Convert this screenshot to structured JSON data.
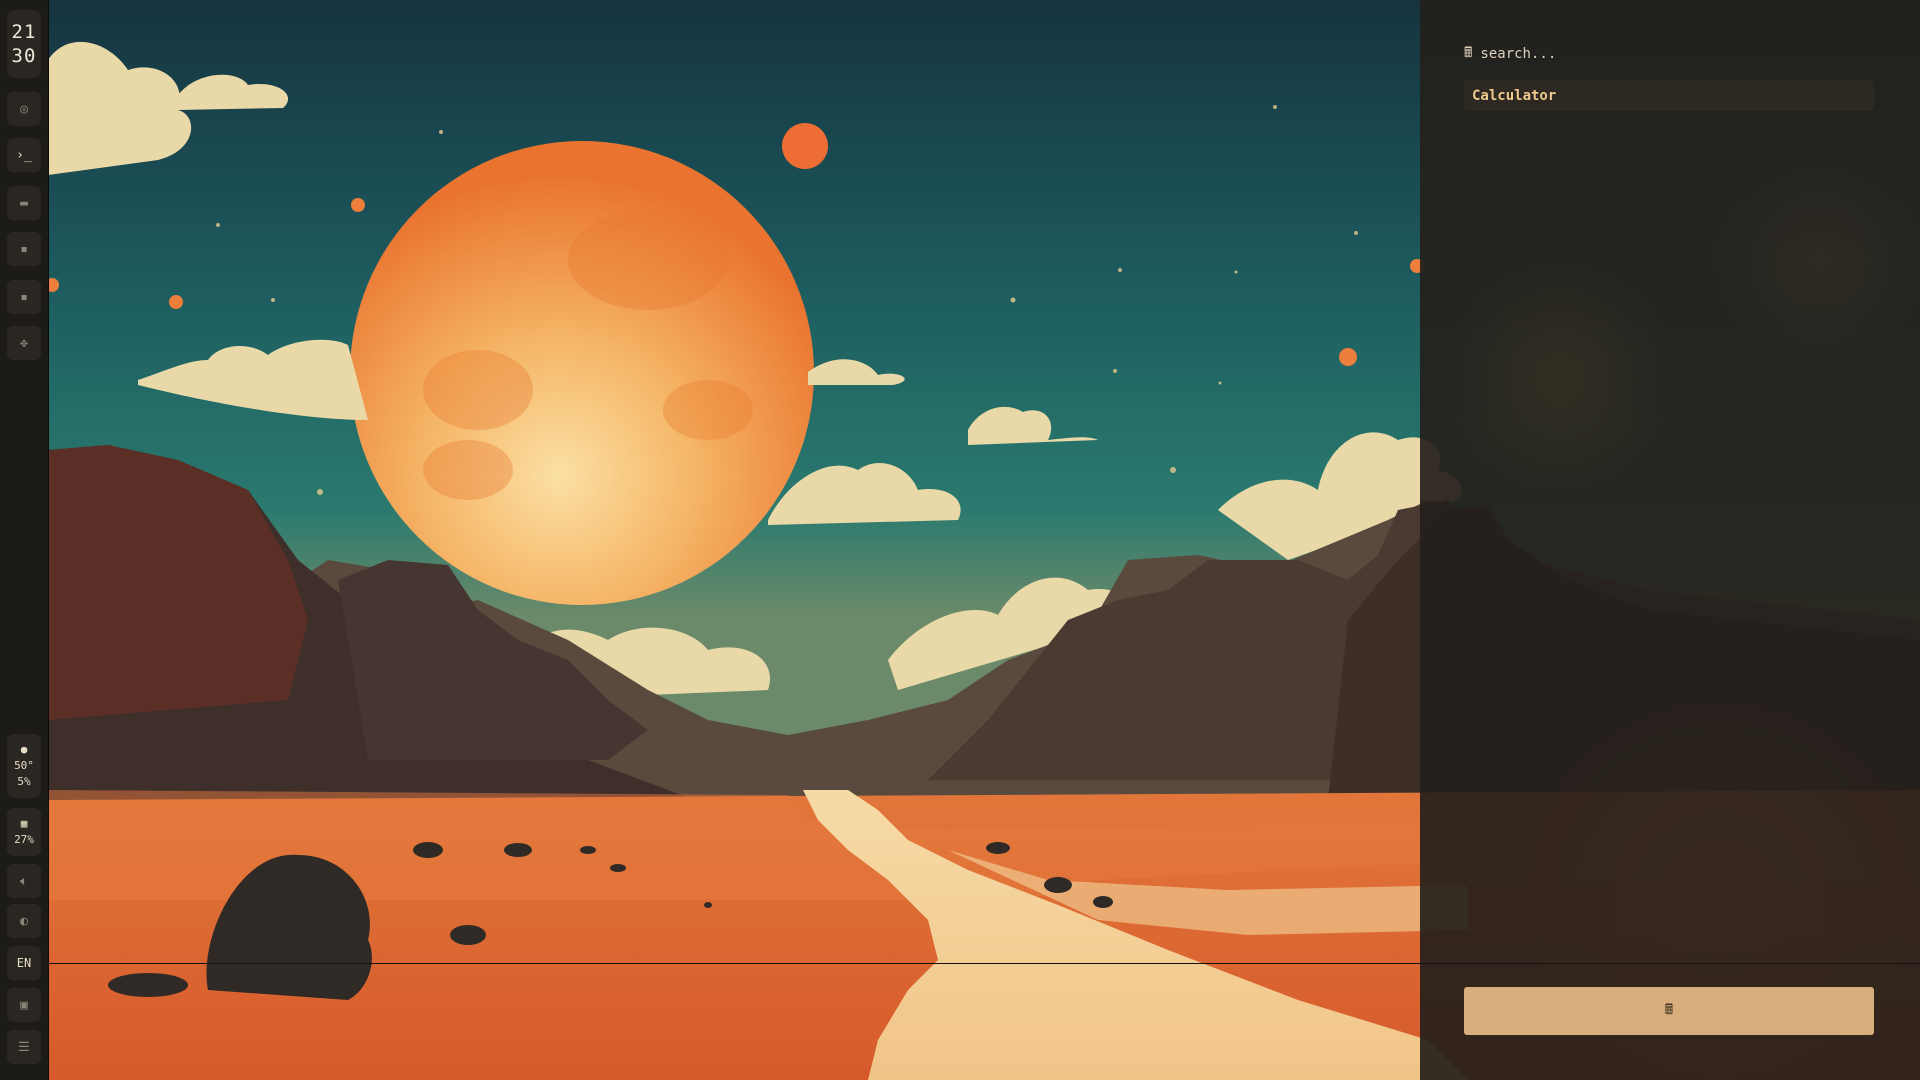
{
  "sidebar": {
    "clock": {
      "hour": "21",
      "minute": "30"
    },
    "workspace_icons": [
      {
        "name": "circle-icon",
        "glyph": "◎",
        "active": false
      },
      {
        "name": "terminal-icon",
        "glyph": "›_",
        "active": true
      },
      {
        "name": "folder-icon",
        "glyph": "▬",
        "active": false
      },
      {
        "name": "note-icon",
        "glyph": "▪",
        "active": false
      },
      {
        "name": "chat-icon",
        "glyph": "▪",
        "active": false
      },
      {
        "name": "game-icon",
        "glyph": "✥",
        "active": false
      }
    ],
    "status": {
      "icon": "cpu-icon",
      "temperature": "50°",
      "usage": "5%"
    },
    "memory": {
      "icon": "memory-icon",
      "usage": "27%"
    },
    "volume": {
      "icon": "volume-icon",
      "glyph": "🔈︎"
    },
    "brightness": {
      "icon": "brightness-icon",
      "glyph": "◐"
    },
    "language": "EN",
    "screenshot": {
      "icon": "screenshot-icon",
      "glyph": "▣"
    },
    "menu": {
      "icon": "list-icon",
      "glyph": "☰"
    }
  },
  "launcher": {
    "search": {
      "icon": "calculator-icon",
      "icon_glyph": "🖩",
      "placeholder": "search..."
    },
    "results": [
      {
        "label": "Calculator"
      }
    ],
    "launch_button": {
      "icon": "calculator-icon",
      "glyph": "🖩"
    }
  },
  "colors": {
    "accent": "#d8ae7c",
    "result_text": "#f0c98d",
    "panel_bg": "#24201b",
    "sky": "#1e6a6a",
    "moon": "#f08a3c"
  }
}
